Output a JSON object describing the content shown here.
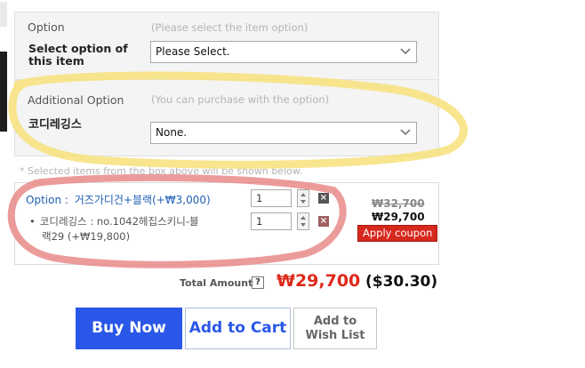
{
  "options": {
    "option_label": "Option",
    "option_hint": "(Please select the item option)",
    "select_label_line1": "Select option of",
    "select_label_line2": "this item",
    "select_value": "Please Select.",
    "additional_label": "Additional Option",
    "additional_hint": "(You can purchase with the option)",
    "addon_label": "코디레깅스",
    "addon_value": "None."
  },
  "note": "* Selected items from the box above will be shown below.",
  "cart": {
    "line1_prefix": "Option : ",
    "line1_text": "거즈가디건+블랙(+₩3,000)",
    "line1_qty": "1",
    "line2_bullet": "•",
    "line2_text_a": "코디레깅스 : no.1042헤집스키니-블",
    "line2_text_b": "랙29 (+₩19,800)",
    "line2_qty": "1",
    "delete_glyph": "×",
    "original_price": "₩32,700",
    "sale_price": "₩29,700",
    "coupon_label": "Apply coupon"
  },
  "total": {
    "label": "Total Amount",
    "help_glyph": "?",
    "price_krw": "₩29,700",
    "price_usd": "($30.30)"
  },
  "buttons": {
    "buy_now": "Buy Now",
    "add_to_cart": "Add to Cart",
    "wish_line1": "Add to",
    "wish_line2": "Wish List"
  },
  "colors": {
    "highlight_yellow": "#f7e07a",
    "highlight_red": "#e98a8a",
    "buy_blue": "#2a57e8",
    "price_red": "#dd2a1b",
    "coupon_red": "#d6281c",
    "link_blue": "#1f60b5"
  }
}
